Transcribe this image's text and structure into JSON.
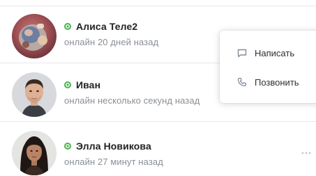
{
  "contacts": [
    {
      "name": "Алиса Теле2",
      "status": "онлайн 20 дней назад",
      "online_indicator": "online-dot-icon",
      "avatar": "avatar-alisa"
    },
    {
      "name": "Иван",
      "status": "онлайн несколько секунд назад",
      "online_indicator": "online-dot-icon",
      "avatar": "avatar-ivan"
    },
    {
      "name": "Элла Новикова",
      "status": "онлайн 27 минут назад",
      "online_indicator": "online-dot-icon",
      "avatar": "avatar-ella"
    }
  ],
  "context_menu": {
    "items": [
      {
        "label": "Написать",
        "icon": "message-icon"
      },
      {
        "label": "Позвонить",
        "icon": "phone-icon"
      }
    ]
  },
  "colors": {
    "online": "#4bb34b",
    "name_text": "#222222",
    "status_text": "#8a8f96",
    "divider": "#e7e8ec",
    "menu_icon": "#818c99"
  }
}
